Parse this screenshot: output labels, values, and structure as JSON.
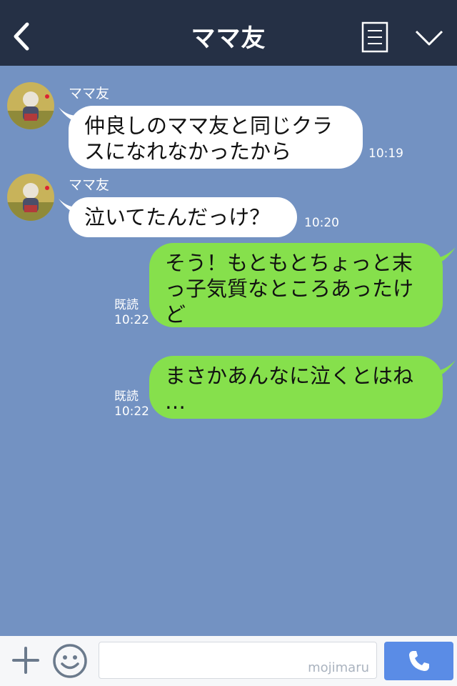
{
  "header": {
    "title": "ママ友",
    "back_icon": "chevron-left-icon",
    "menu_icon": "notes-icon",
    "expand_icon": "chevron-down-icon",
    "background": "#253045"
  },
  "chat": {
    "background": "#7392c2",
    "messages": [
      {
        "side": "in",
        "sender": "ママ友",
        "text_lines": [
          "仲良しのママ友と同じクラ",
          "スになれなかったから"
        ],
        "time": "10:19"
      },
      {
        "side": "in",
        "sender": "ママ友",
        "text_lines": [
          "泣いてたんだっけ？"
        ],
        "time": "10:20"
      },
      {
        "side": "out",
        "read": "既読",
        "text_lines": [
          "そう！もともとちょっと末",
          "っ子気質なところあったけ",
          "ど"
        ],
        "time": "10:22"
      },
      {
        "side": "out",
        "read": "既読",
        "text_lines": [
          "まさかあんなに泣くとはね",
          "…"
        ],
        "time": "10:22"
      }
    ],
    "incoming_color": "#ffffff",
    "outgoing_color": "#86e04c"
  },
  "footer": {
    "add_icon": "plus-icon",
    "emoji_icon": "smiley-icon",
    "input_value": "",
    "watermark": "mojimaru",
    "call_icon": "phone-icon",
    "call_button_color": "#5a8ce6"
  }
}
